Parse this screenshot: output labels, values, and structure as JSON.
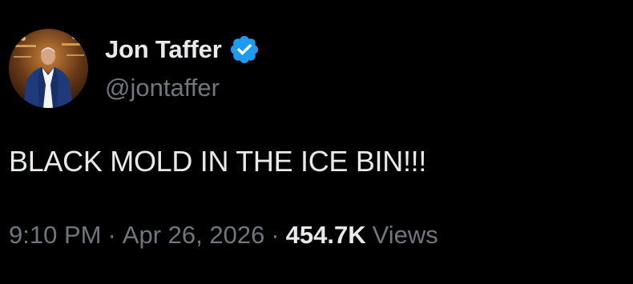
{
  "author": {
    "display_name": "Jon Taffer",
    "handle": "@jontaffer",
    "verified_icon": "verified-badge-icon",
    "avatar_icon": "profile-photo"
  },
  "tweet": {
    "text": "BLACK MOLD IN THE ICE BIN!!!"
  },
  "meta": {
    "time": "9:10 PM",
    "separator": "·",
    "date": "Apr 26, 2026",
    "views_count": "454.7K",
    "views_label": "Views"
  },
  "colors": {
    "background": "#000000",
    "primary_text": "#e7e9ea",
    "secondary_text": "#71767b",
    "verified_blue": "#1d9bf0"
  }
}
